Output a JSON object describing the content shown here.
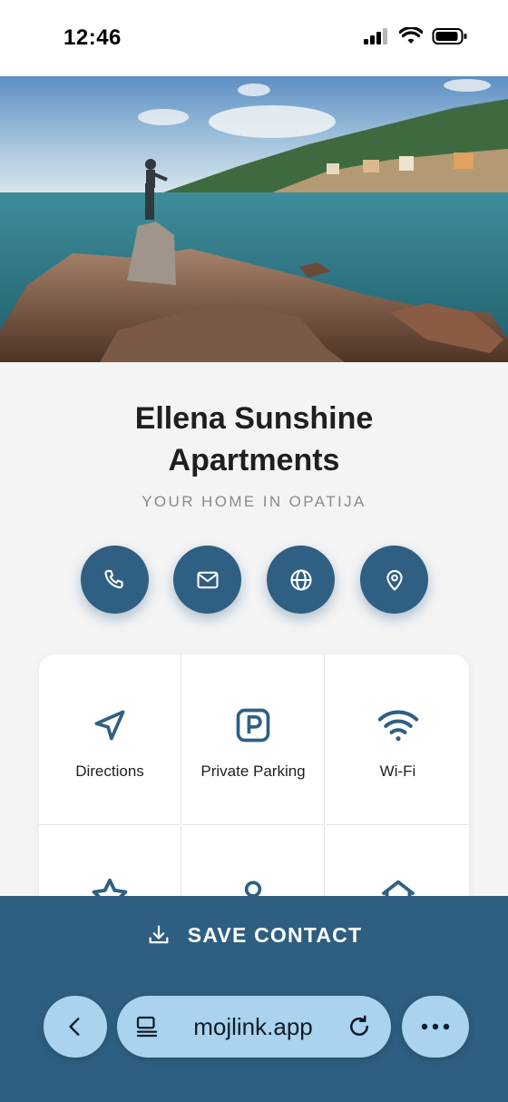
{
  "status_bar": {
    "time": "12:46"
  },
  "hero": {
    "image_alt": "Opatija coastline with statue on rocks"
  },
  "header": {
    "title": "Ellena Sunshine Apartments",
    "subtitle": "YOUR HOME IN OPATIJA"
  },
  "actions": [
    {
      "icon": "phone-icon"
    },
    {
      "icon": "mail-icon"
    },
    {
      "icon": "globe-icon"
    },
    {
      "icon": "location-pin-icon"
    }
  ],
  "grid": {
    "items": [
      {
        "label": "Directions",
        "icon": "navigation-arrow-icon"
      },
      {
        "label": "Private Parking",
        "icon": "parking-icon"
      },
      {
        "label": "Wi-Fi",
        "icon": "wifi-icon"
      },
      {
        "label": "",
        "icon": "star-icon"
      },
      {
        "label": "",
        "icon": "person-icon"
      },
      {
        "label": "",
        "icon": "home-icon"
      }
    ]
  },
  "save_contact": {
    "label": "SAVE CONTACT",
    "icon": "download-icon"
  },
  "browser": {
    "url": "mojlink.app"
  },
  "colors": {
    "accent": "#2f5f83",
    "panel": "#2e5f80",
    "pill": "#a9d3ee"
  }
}
